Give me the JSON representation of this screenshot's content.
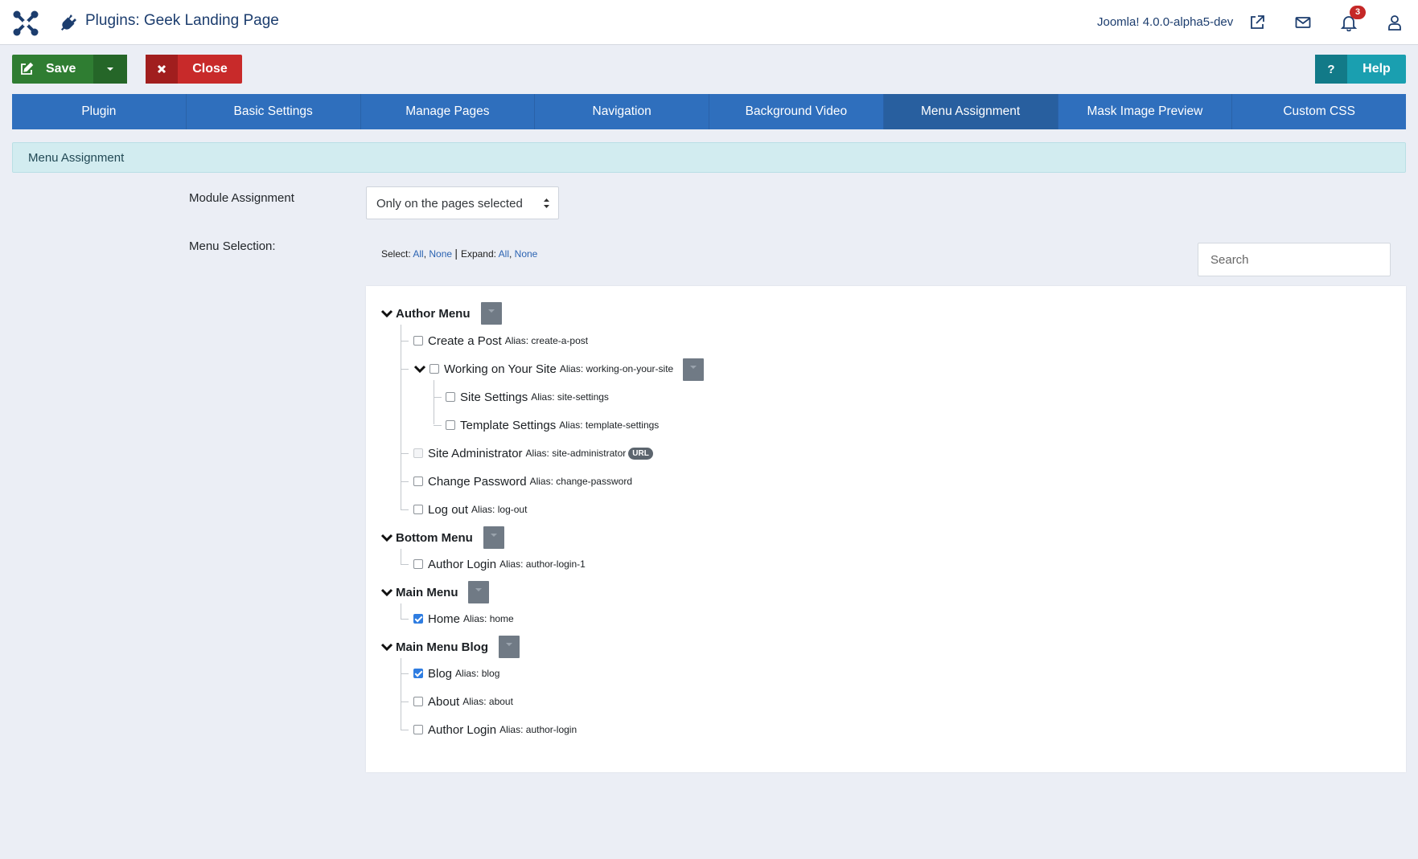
{
  "header": {
    "title": "Plugins: Geek Landing Page",
    "version": "Joomla! 4.0.0-alpha5-dev",
    "notification_count": "3",
    "icons": [
      "joomla-logo-icon",
      "plug-icon",
      "external-link-icon",
      "mail-icon",
      "bell-icon",
      "user-icon"
    ]
  },
  "toolbar": {
    "save_label": "Save",
    "close_label": "Close",
    "help_label": "Help",
    "help_icon": "?"
  },
  "tabs": [
    {
      "label": "Plugin",
      "active": false
    },
    {
      "label": "Basic Settings",
      "active": false
    },
    {
      "label": "Manage Pages",
      "active": false
    },
    {
      "label": "Navigation",
      "active": false
    },
    {
      "label": "Background Video",
      "active": false
    },
    {
      "label": "Menu Assignment",
      "active": true
    },
    {
      "label": "Mask Image Preview",
      "active": false
    },
    {
      "label": "Custom CSS",
      "active": false
    }
  ],
  "section": {
    "heading": "Menu Assignment"
  },
  "form": {
    "module_assignment_label": "Module Assignment",
    "module_assignment_value": "Only on the pages selected",
    "menu_selection_label": "Menu Selection:",
    "select_label": "Select:",
    "expand_label": "Expand:",
    "all_link": "All",
    "none_link": "None",
    "search_placeholder": "Search"
  },
  "tree": {
    "alias_prefix": "Alias:",
    "menus": [
      {
        "title": "Author Menu",
        "items": [
          {
            "name": "Create a Post",
            "alias": "create-a-post",
            "checked": false
          },
          {
            "name": "Working on Your Site",
            "alias": "working-on-your-site",
            "checked": false,
            "children": [
              {
                "name": "Site Settings",
                "alias": "site-settings",
                "checked": false
              },
              {
                "name": "Template Settings",
                "alias": "template-settings",
                "checked": false
              }
            ]
          },
          {
            "name": "Site Administrator",
            "alias": "site-administrator",
            "checked": false,
            "disabled": true,
            "badge": "URL"
          },
          {
            "name": "Change Password",
            "alias": "change-password",
            "checked": false
          },
          {
            "name": "Log out",
            "alias": "log-out",
            "checked": false
          }
        ]
      },
      {
        "title": "Bottom Menu",
        "items": [
          {
            "name": "Author Login",
            "alias": "author-login-1",
            "checked": false
          }
        ]
      },
      {
        "title": "Main Menu",
        "items": [
          {
            "name": "Home",
            "alias": "home",
            "checked": true
          }
        ]
      },
      {
        "title": "Main Menu Blog",
        "items": [
          {
            "name": "Blog",
            "alias": "blog",
            "checked": true
          },
          {
            "name": "About",
            "alias": "about",
            "checked": false
          },
          {
            "name": "Author Login",
            "alias": "author-login",
            "checked": false
          }
        ]
      }
    ]
  },
  "colors": {
    "save": "#2f7d32",
    "close": "#c82a2a",
    "help": "#1a9fb0",
    "tabs": "#2f6fbd",
    "tab_active": "#285f9f",
    "checkbox_checked": "#2f7de1"
  }
}
